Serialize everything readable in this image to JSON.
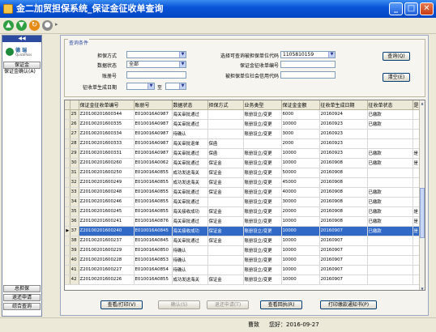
{
  "window": {
    "title": "金二加贸担保系统_保证金征收单查询",
    "btn_min": "_",
    "btn_max": "□",
    "btn_close": "✕"
  },
  "sidebar": {
    "collapse": "◀◀",
    "logo_name": "德 瑞",
    "logo_sub": "QuickPass",
    "section_button": "保证金",
    "items": [
      "保证金确认(A)"
    ],
    "bottom_buttons": [
      "总担保",
      "退还申请",
      "综合查询"
    ]
  },
  "filters": {
    "group_title": "查询条件",
    "guarantee_method_label": "担保方式",
    "guarantee_method_value": "",
    "data_status_label": "数据状态",
    "data_status_value": "全部",
    "ledger_no_label": "账册号",
    "ledger_no_value": "",
    "creation_date_label": "征收单生成日期",
    "date_to_label": "至",
    "unit_code_label": "选择可查询被担保单位代码",
    "unit_code_value": "1105810159",
    "collect_no_label": "保证金征收单编号",
    "collect_no_value": "",
    "credit_code_label": "被担保单位社会信用代码",
    "credit_code_value": "",
    "query_button": "查询(Q)",
    "clear_button": "清空(E)"
  },
  "table": {
    "columns": [
      "保证金征收单编号",
      "账册号",
      "数据状态",
      "担保方式",
      "业务类型",
      "保证金金额",
      "征收单生成日期",
      "征收单状态",
      "是"
    ],
    "rows": [
      {
        "n": "25",
        "id": "Z20100201600344",
        "ledger": "E010016A0987",
        "status": "海关审批通过",
        "method": "",
        "type": "账册设立/变更",
        "amount": "6000",
        "date": "20160924",
        "state": "已缴款",
        "flag": ""
      },
      {
        "n": "26",
        "id": "Z20100201600335",
        "ledger": "E010016A0987",
        "status": "海关审批通过",
        "method": "",
        "type": "账册设立/变更",
        "amount": "10000",
        "date": "20160923",
        "state": "已缴款",
        "flag": ""
      },
      {
        "n": "27",
        "id": "Z20100201600334",
        "ledger": "E010016A0987",
        "status": "待确认",
        "method": "",
        "type": "账册设立/变更",
        "amount": "3000",
        "date": "20160923",
        "state": "",
        "flag": ""
      },
      {
        "n": "28",
        "id": "Z20100201600333",
        "ledger": "E010016A0987",
        "status": "海关审批退单",
        "method": "保函",
        "type": "",
        "amount": "2000",
        "date": "20160923",
        "state": "",
        "flag": ""
      },
      {
        "n": "29",
        "id": "Z20100201600331",
        "ledger": "E010016A0987",
        "status": "海关审批通过",
        "method": "保函",
        "type": "账册设立/变更",
        "amount": "10000",
        "date": "20160923",
        "state": "已缴款",
        "flag": "是"
      },
      {
        "n": "30",
        "id": "Z20100201600260",
        "ledger": "E010016A0062",
        "status": "海关审批通过",
        "method": "保证金",
        "type": "账册设立/变更",
        "amount": "10000",
        "date": "20160908",
        "state": "已缴款",
        "flag": "是"
      },
      {
        "n": "31",
        "id": "Z20100201600250",
        "ledger": "E010016A0855",
        "status": "成功发送海关",
        "method": "保证金",
        "type": "账册设立/变更",
        "amount": "50000",
        "date": "20160908",
        "state": "",
        "flag": ""
      },
      {
        "n": "32",
        "id": "Z20100201600249",
        "ledger": "E010016A0855",
        "status": "成功发送海关",
        "method": "保证金",
        "type": "账册设立/变更",
        "amount": "45000",
        "date": "20160908",
        "state": "",
        "flag": ""
      },
      {
        "n": "33",
        "id": "Z20100201600248",
        "ledger": "E010016A0855",
        "status": "海关审批通过",
        "method": "保证金",
        "type": "账册设立/变更",
        "amount": "40000",
        "date": "20160908",
        "state": "已缴款",
        "flag": ""
      },
      {
        "n": "34",
        "id": "Z20100201600246",
        "ledger": "E010016A0855",
        "status": "海关审批通过",
        "method": "",
        "type": "账册设立/变更",
        "amount": "30000",
        "date": "20160908",
        "state": "已缴款",
        "flag": ""
      },
      {
        "n": "35",
        "id": "Z20100201600245",
        "ledger": "E010016A0855",
        "status": "海关接收成功",
        "method": "保证金",
        "type": "账册设立/变更",
        "amount": "20000",
        "date": "20160908",
        "state": "已缴款",
        "flag": "是"
      },
      {
        "n": "36",
        "id": "Z20100201600241",
        "ledger": "E010016A0876",
        "status": "海关审批通过",
        "method": "保证金",
        "type": "账册设立/变更",
        "amount": "10000",
        "date": "20160908",
        "state": "已缴款",
        "flag": "是"
      },
      {
        "n": "37",
        "id": "Z20100201600240",
        "ledger": "E010016A0845",
        "status": "海关接收成功",
        "method": "保证金",
        "type": "账册设立/变更",
        "amount": "10000",
        "date": "20160907",
        "state": "已缴款",
        "flag": "是"
      },
      {
        "n": "38",
        "id": "Z20100201600237",
        "ledger": "E010016A0845",
        "status": "海关审批通过",
        "method": "保证金",
        "type": "账册设立/变更",
        "amount": "10000",
        "date": "20160907",
        "state": "",
        "flag": ""
      },
      {
        "n": "39",
        "id": "Z20100201600229",
        "ledger": "E010016A0850",
        "status": "待确认",
        "method": "",
        "type": "账册设立/变更",
        "amount": "10000",
        "date": "20160907",
        "state": "",
        "flag": ""
      },
      {
        "n": "40",
        "id": "Z20100201600228",
        "ledger": "E010016A0853",
        "status": "待确认",
        "method": "",
        "type": "账册设立/变更",
        "amount": "10000",
        "date": "20160907",
        "state": "",
        "flag": ""
      },
      {
        "n": "41",
        "id": "Z20100201600227",
        "ledger": "E010016A0854",
        "status": "待确认",
        "method": "",
        "type": "账册设立/变更",
        "amount": "10000",
        "date": "20160907",
        "state": "",
        "flag": ""
      },
      {
        "n": "42",
        "id": "Z20100201600226",
        "ledger": "E010016A0855",
        "status": "成功发送海关",
        "method": "保证金",
        "type": "账册设立/变更",
        "amount": "10000",
        "date": "20160907",
        "state": "",
        "flag": ""
      }
    ],
    "selected_row": "37",
    "pointer": "▶"
  },
  "actions": {
    "view_print": "查看/打印(V)",
    "confirm": "确认(S)",
    "refund": "退还申请(T)",
    "view_receipt": "查看回执(R)",
    "print_notice": "打印缴款通知书(P)"
  },
  "status": {
    "user": "曹致",
    "date_text": "您好：2016-09-27"
  },
  "colors": {
    "title_blue": "#0a55d8",
    "selection": "#3169c6",
    "panel": "#ece9d8"
  }
}
